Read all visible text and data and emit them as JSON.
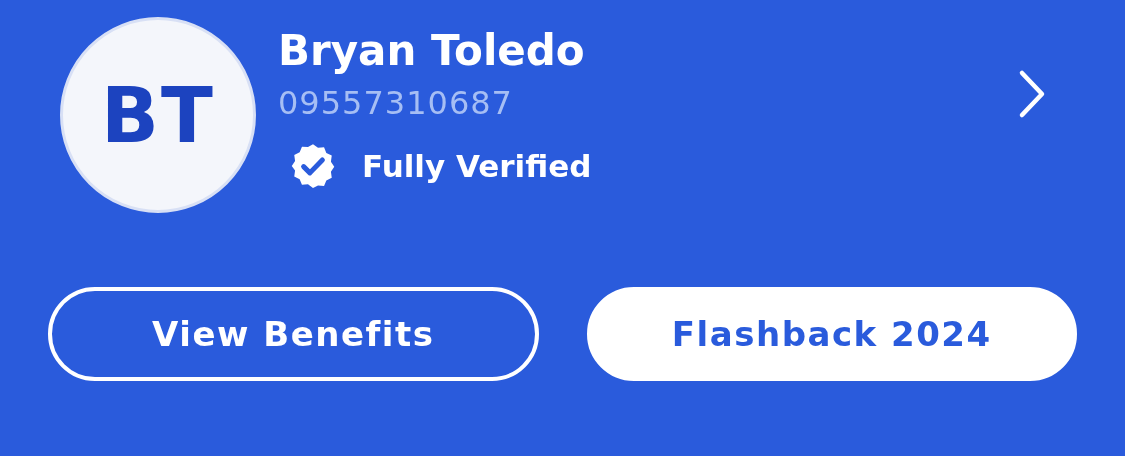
{
  "profile": {
    "initials": "BT",
    "name": "Bryan Toledo",
    "phone": "09557310687",
    "verification": {
      "label": "Fully Verified",
      "verified": true
    }
  },
  "buttons": [
    {
      "label": "View Benefits",
      "kind": "outline"
    },
    {
      "label": "Flashback 2024",
      "kind": "filled"
    }
  ]
}
